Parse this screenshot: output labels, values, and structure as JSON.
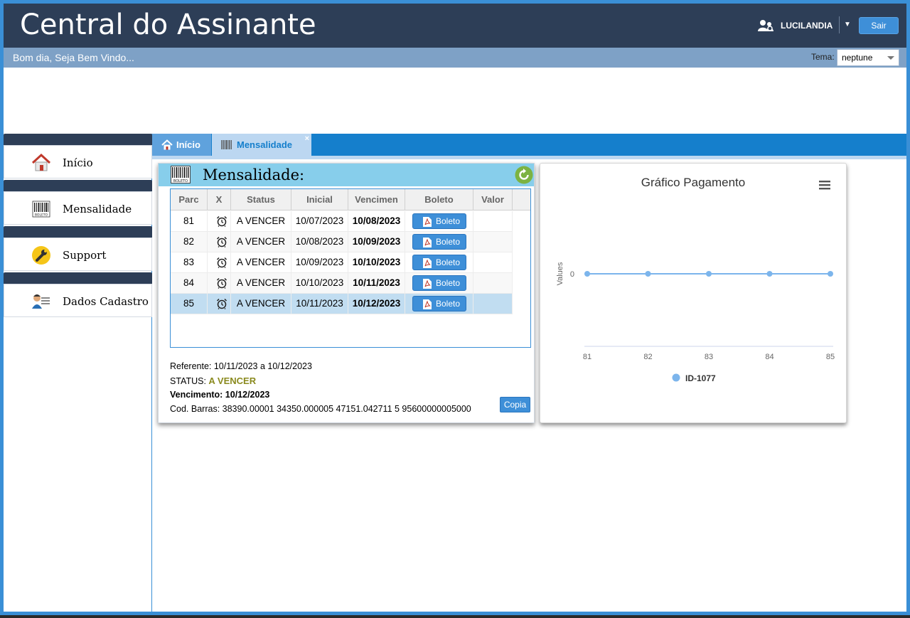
{
  "header": {
    "title": "Central do Assinante",
    "user_name": "LUCILANDIA",
    "logout_label": "Sair"
  },
  "subheader": {
    "greeting": "Bom dia, Seja Bem Vindo...",
    "theme_label": "Tema:",
    "theme_value": "neptune"
  },
  "sidebar": {
    "items": [
      {
        "label": "Início",
        "icon": "home-icon"
      },
      {
        "label": "Mensalidade",
        "icon": "barcode-icon"
      },
      {
        "label": "Support",
        "icon": "wrench-icon"
      },
      {
        "label": "Dados Cadastro",
        "icon": "user-card-icon"
      }
    ]
  },
  "tabs": [
    {
      "label": "Início",
      "icon": "home-icon"
    },
    {
      "label": "Mensalidade",
      "icon": "barcode-icon",
      "close": "×"
    }
  ],
  "panel": {
    "title": "Mensalidade:",
    "barcode_text": "BOLETO",
    "columns": [
      "Parc",
      "X",
      "Status",
      "Inicial",
      "Vencimen",
      "Boleto",
      "Valor"
    ],
    "rows": [
      {
        "parc": "81",
        "status": "A VENCER",
        "inicial": "10/07/2023",
        "vencimento": "10/08/2023",
        "boleto": "Boleto",
        "valor": ""
      },
      {
        "parc": "82",
        "status": "A VENCER",
        "inicial": "10/08/2023",
        "vencimento": "10/09/2023",
        "boleto": "Boleto",
        "valor": ""
      },
      {
        "parc": "83",
        "status": "A VENCER",
        "inicial": "10/09/2023",
        "vencimento": "10/10/2023",
        "boleto": "Boleto",
        "valor": ""
      },
      {
        "parc": "84",
        "status": "A VENCER",
        "inicial": "10/10/2023",
        "vencimento": "10/11/2023",
        "boleto": "Boleto",
        "valor": ""
      },
      {
        "parc": "85",
        "status": "A VENCER",
        "inicial": "10/11/2023",
        "vencimento": "10/12/2023",
        "boleto": "Boleto",
        "valor": ""
      }
    ],
    "selected_row": 4,
    "info": {
      "referente": "Referente: 10/11/2023 a 10/12/2023",
      "status_label": "STATUS: ",
      "status_value": "A VENCER",
      "vencimento": "Vencimento: 10/12/2023",
      "cod_barras": "Cod. Barras: 38390.00001 34350.000005 47151.042711 5 95600000005000"
    },
    "copy_label": "Copia"
  },
  "chart_data": {
    "type": "line",
    "title": "Gráfico Pagamento",
    "xlabel": "",
    "ylabel": "Values",
    "x": [
      "81",
      "82",
      "83",
      "84",
      "85"
    ],
    "y_ticks": [
      "0"
    ],
    "series": [
      {
        "name": "ID-1077",
        "values": [
          0,
          0,
          0,
          0,
          0
        ],
        "color": "#7cb5ec"
      }
    ],
    "legend": "bottom-center",
    "grid": false
  },
  "colors": {
    "header": "#2d3e57",
    "subheader": "#7ea1c6",
    "accent": "#157fcc",
    "status": "#8a8a1e"
  }
}
